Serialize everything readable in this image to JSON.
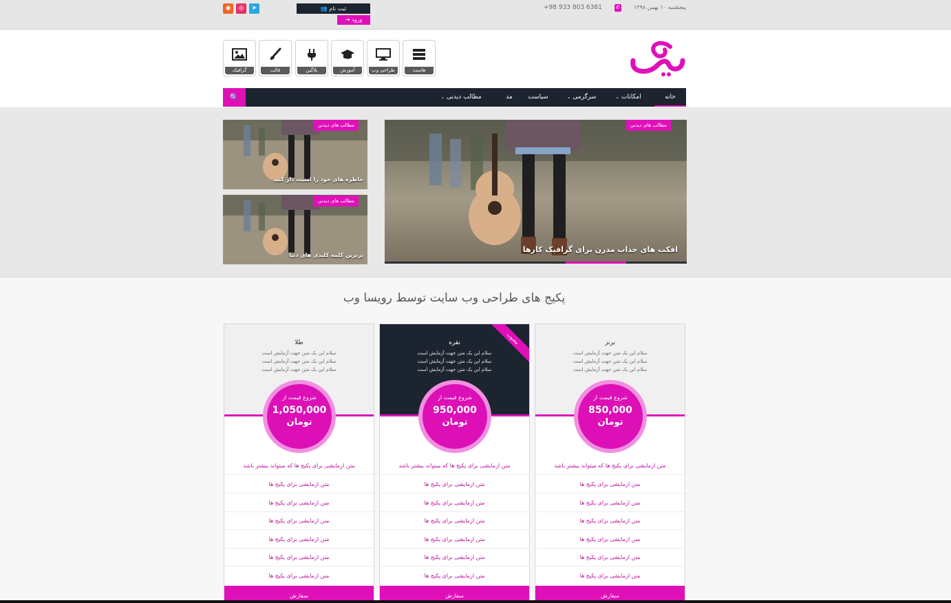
{
  "topbar": {
    "date": "پنجشنبه ۱۰ بهمن ۱۳۹۸",
    "phone": "+98 933 803 6381",
    "register_label": "ثبت نام",
    "login_label": "ورود",
    "social": [
      {
        "name": "telegram",
        "color": "#2ca5e0",
        "glyph": "➤"
      },
      {
        "name": "instagram",
        "color": "#e1306c",
        "glyph": "◎"
      },
      {
        "name": "rss",
        "color": "#f26522",
        "glyph": "◉"
      }
    ]
  },
  "header": {
    "categories": [
      {
        "label": "هاست",
        "icon": "server-icon"
      },
      {
        "label": "طراحی وب",
        "icon": "monitor-icon"
      },
      {
        "label": "آموزش",
        "icon": "graduation-cap-icon"
      },
      {
        "label": "پلاگین",
        "icon": "plug-icon"
      },
      {
        "label": "قالب",
        "icon": "paintbrush-icon"
      },
      {
        "label": "گرافیک",
        "icon": "image-icon"
      }
    ]
  },
  "nav": {
    "items": [
      {
        "label": "خانه",
        "dropdown": false,
        "active": true
      },
      {
        "label": "امکانات",
        "dropdown": true
      },
      {
        "label": "سرگرمی",
        "dropdown": true
      },
      {
        "label": "سیاست",
        "dropdown": false
      },
      {
        "label": "مد",
        "dropdown": false
      },
      {
        "label": "مطالب دیدنی",
        "dropdown": true
      }
    ]
  },
  "featured": {
    "main": {
      "badge": "مطالب های دیدنی",
      "caption": "افکت های جذاب مدرن برای گرافیک کارها"
    },
    "side": [
      {
        "badge": "مطالب های دیدنی",
        "caption": "خاطره های خود را امنیت دار کنید"
      },
      {
        "badge": "مطالب های دیدنی",
        "caption": "برترین کلمه کلیدی های دنیا"
      }
    ]
  },
  "pricing": {
    "title": "پکیج های طراحی وب سایت توسط رویسا وب",
    "popular_label": "محبوب",
    "desc_line": "سلام این یک متن جهت آزمایش است",
    "from_label": "شروع قیمت از",
    "currency": "تومان",
    "long_feature": "متن ازمایشی برای پکیج ها که میتواند بیشتر باشد",
    "feature": "متن ازمایشی برای پکیج ها",
    "order_label": "سفارش",
    "plans": [
      {
        "name": "برنز",
        "price": "850,000",
        "dark": false
      },
      {
        "name": "نقره",
        "price": "950,000",
        "dark": true
      },
      {
        "name": "طلا",
        "price": "1,050,000",
        "dark": false
      }
    ]
  },
  "colors": {
    "accent": "#e010b9",
    "dark": "#1c2430"
  }
}
